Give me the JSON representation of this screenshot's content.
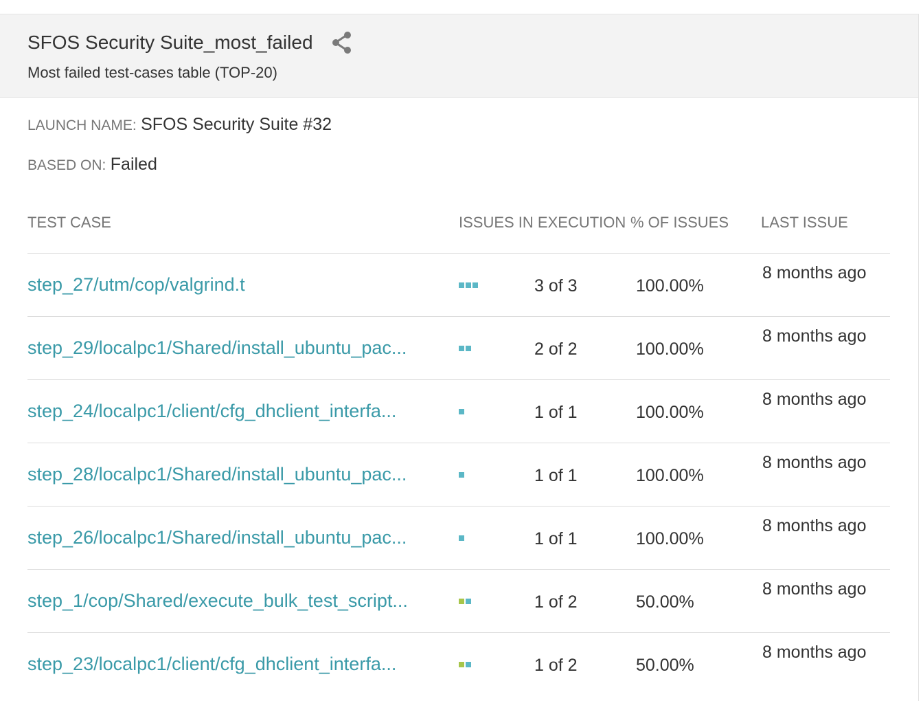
{
  "widget": {
    "title": "SFOS Security Suite_most_failed",
    "subtitle": "Most failed test-cases table (TOP-20)",
    "share_icon": "share-icon"
  },
  "launch": {
    "label": "LAUNCH NAME:",
    "value": "SFOS Security Suite #32"
  },
  "based_on": {
    "label": "BASED ON:",
    "value": "Failed"
  },
  "columns": {
    "test_case": "TEST CASE",
    "issues_in_execution": "ISSUES IN EXECUTION",
    "percent_of_issues": "% OF ISSUES",
    "last_issue": "LAST ISSUE"
  },
  "colors": {
    "failed": "#5bb7c6",
    "passed": "#a7c54a",
    "link": "#3a9aa8"
  },
  "rows": [
    {
      "name": "step_27/utm/cop/valgrind.t",
      "bars": [
        "failed",
        "failed",
        "failed"
      ],
      "count": "3 of 3",
      "percent": "100.00%",
      "last": "8 months ago"
    },
    {
      "name": "step_29/localpc1/Shared/install_ubuntu_pac...",
      "bars": [
        "failed",
        "failed"
      ],
      "count": "2 of 2",
      "percent": "100.00%",
      "last": "8 months ago"
    },
    {
      "name": "step_24/localpc1/client/cfg_dhclient_interfa...",
      "bars": [
        "failed"
      ],
      "count": "1 of 1",
      "percent": "100.00%",
      "last": "8 months ago"
    },
    {
      "name": "step_28/localpc1/Shared/install_ubuntu_pac...",
      "bars": [
        "failed"
      ],
      "count": "1 of 1",
      "percent": "100.00%",
      "last": "8 months ago"
    },
    {
      "name": "step_26/localpc1/Shared/install_ubuntu_pac...",
      "bars": [
        "failed"
      ],
      "count": "1 of 1",
      "percent": "100.00%",
      "last": "8 months ago"
    },
    {
      "name": "step_1/cop/Shared/execute_bulk_test_script...",
      "bars": [
        "passed",
        "failed"
      ],
      "count": "1 of 2",
      "percent": "50.00%",
      "last": "8 months ago"
    },
    {
      "name": "step_23/localpc1/client/cfg_dhclient_interfa...",
      "bars": [
        "passed",
        "failed"
      ],
      "count": "1 of 2",
      "percent": "50.00%",
      "last": "8 months ago"
    }
  ]
}
